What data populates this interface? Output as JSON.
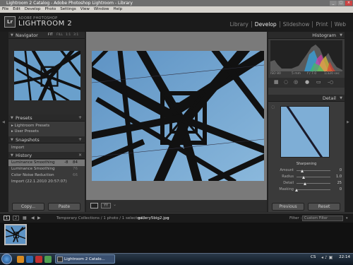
{
  "window": {
    "title": "Lightroom 2 Catalog - Adobe Photoshop Lightroom - Library"
  },
  "menu": [
    "File",
    "Edit",
    "Develop",
    "Photo",
    "Settings",
    "View",
    "Window",
    "Help"
  ],
  "logo": {
    "badge": "Lr",
    "line1": "ADOBE PHOTOSHOP",
    "line2": "LIGHTROOM 2"
  },
  "modules": [
    "Library",
    "Develop",
    "Slideshow",
    "Print",
    "Web"
  ],
  "navigator": {
    "title": "Navigator",
    "zoom": [
      "FIT",
      "FILL",
      "1:1",
      "3:1"
    ]
  },
  "presets": {
    "title": "Presets",
    "items": [
      "Lightroom Presets",
      "User Presets"
    ]
  },
  "snapshots": {
    "title": "Snapshots",
    "items": [
      "Import"
    ]
  },
  "history": {
    "title": "History",
    "items": [
      {
        "label": "Luminance Smoothing",
        "a": "-8",
        "b": "84"
      },
      {
        "label": "Luminance Smoothing",
        "a": "",
        "b": "76"
      },
      {
        "label": "Color Noise Reduction",
        "a": "",
        "b": "66"
      },
      {
        "label": "Import (22.1.2010 20:57:07)",
        "a": "",
        "b": ""
      }
    ]
  },
  "left_buttons": {
    "copy": "Copy...",
    "paste": "Paste"
  },
  "histogram": {
    "title": "Histogram",
    "iso": "ISO 80",
    "focal": "5 mm",
    "aperture": "f / 7.0",
    "shutter": "1/320 sec"
  },
  "detail": {
    "title": "Detail",
    "section": "Sharpening",
    "rows": [
      {
        "label": "Amount",
        "value": "0"
      },
      {
        "label": "Radius",
        "value": "1.0"
      },
      {
        "label": "Detail",
        "value": "25"
      },
      {
        "label": "Masking",
        "value": "0"
      }
    ]
  },
  "right_buttons": {
    "previous": "Previous",
    "reset": "Reset"
  },
  "filmstrip": {
    "pages": [
      "1",
      "2"
    ],
    "path": "Temporary Collections / 1 photo / 1 selected /",
    "file": "gallery5big2.jpg",
    "filter_label": "Filter :",
    "filter_value": "Custom Filter"
  },
  "taskbar": {
    "task": "Lightroom 2 Catalo...",
    "lang": "CS",
    "clock": "22:14"
  }
}
